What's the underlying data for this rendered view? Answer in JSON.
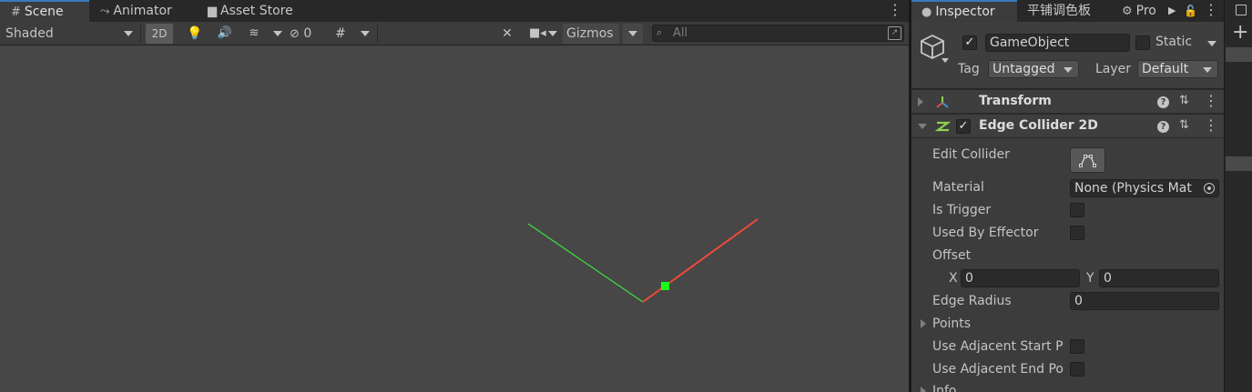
{
  "scene_window": {
    "tabs": [
      {
        "label": "Scene",
        "icon": "grid-icon",
        "active": true
      },
      {
        "label": "Animator",
        "icon": "animator-icon",
        "active": false
      },
      {
        "label": "Asset Store",
        "icon": "store-bag-icon",
        "active": false
      }
    ],
    "toolbar": {
      "shading_mode": "Shaded",
      "toggle_2d": "2D",
      "hidden_count": "0",
      "gizmos": "Gizmos",
      "search_placeholder": "All"
    }
  },
  "scene_view": {
    "background": "#474747",
    "green_line_color": "#3fe03f",
    "red_line_color": "#f04a3a",
    "handle_color": "#16ff16"
  },
  "inspector": {
    "tabs": [
      {
        "label": "Inspector",
        "icon": "info-icon",
        "active": true
      },
      {
        "label": "平铺调色板",
        "active": false
      },
      {
        "label": "Pro",
        "icon": "gear-icon",
        "active": false
      }
    ],
    "gameobject": {
      "active": true,
      "name": "GameObject",
      "static_label": "Static",
      "tag_label": "Tag",
      "tag_value": "Untagged",
      "layer_label": "Layer",
      "layer_value": "Default"
    },
    "components": [
      {
        "title": "Transform",
        "expanded": false
      },
      {
        "title": "Edge Collider 2D",
        "expanded": true,
        "enabled": true
      }
    ],
    "edge_collider": {
      "edit_collider_label": "Edit Collider",
      "material_label": "Material",
      "material_value": "None (Physics Mat",
      "is_trigger_label": "Is Trigger",
      "used_by_effector_label": "Used By Effector",
      "offset_label": "Offset",
      "offset_x_label": "X",
      "offset_x": "0",
      "offset_y_label": "Y",
      "offset_y": "0",
      "edge_radius_label": "Edge Radius",
      "edge_radius": "0",
      "points_label": "Points",
      "use_adjacent_start_label": "Use Adjacent Start P",
      "use_adjacent_end_label": "Use Adjacent End Po",
      "info_label": "Info"
    }
  }
}
